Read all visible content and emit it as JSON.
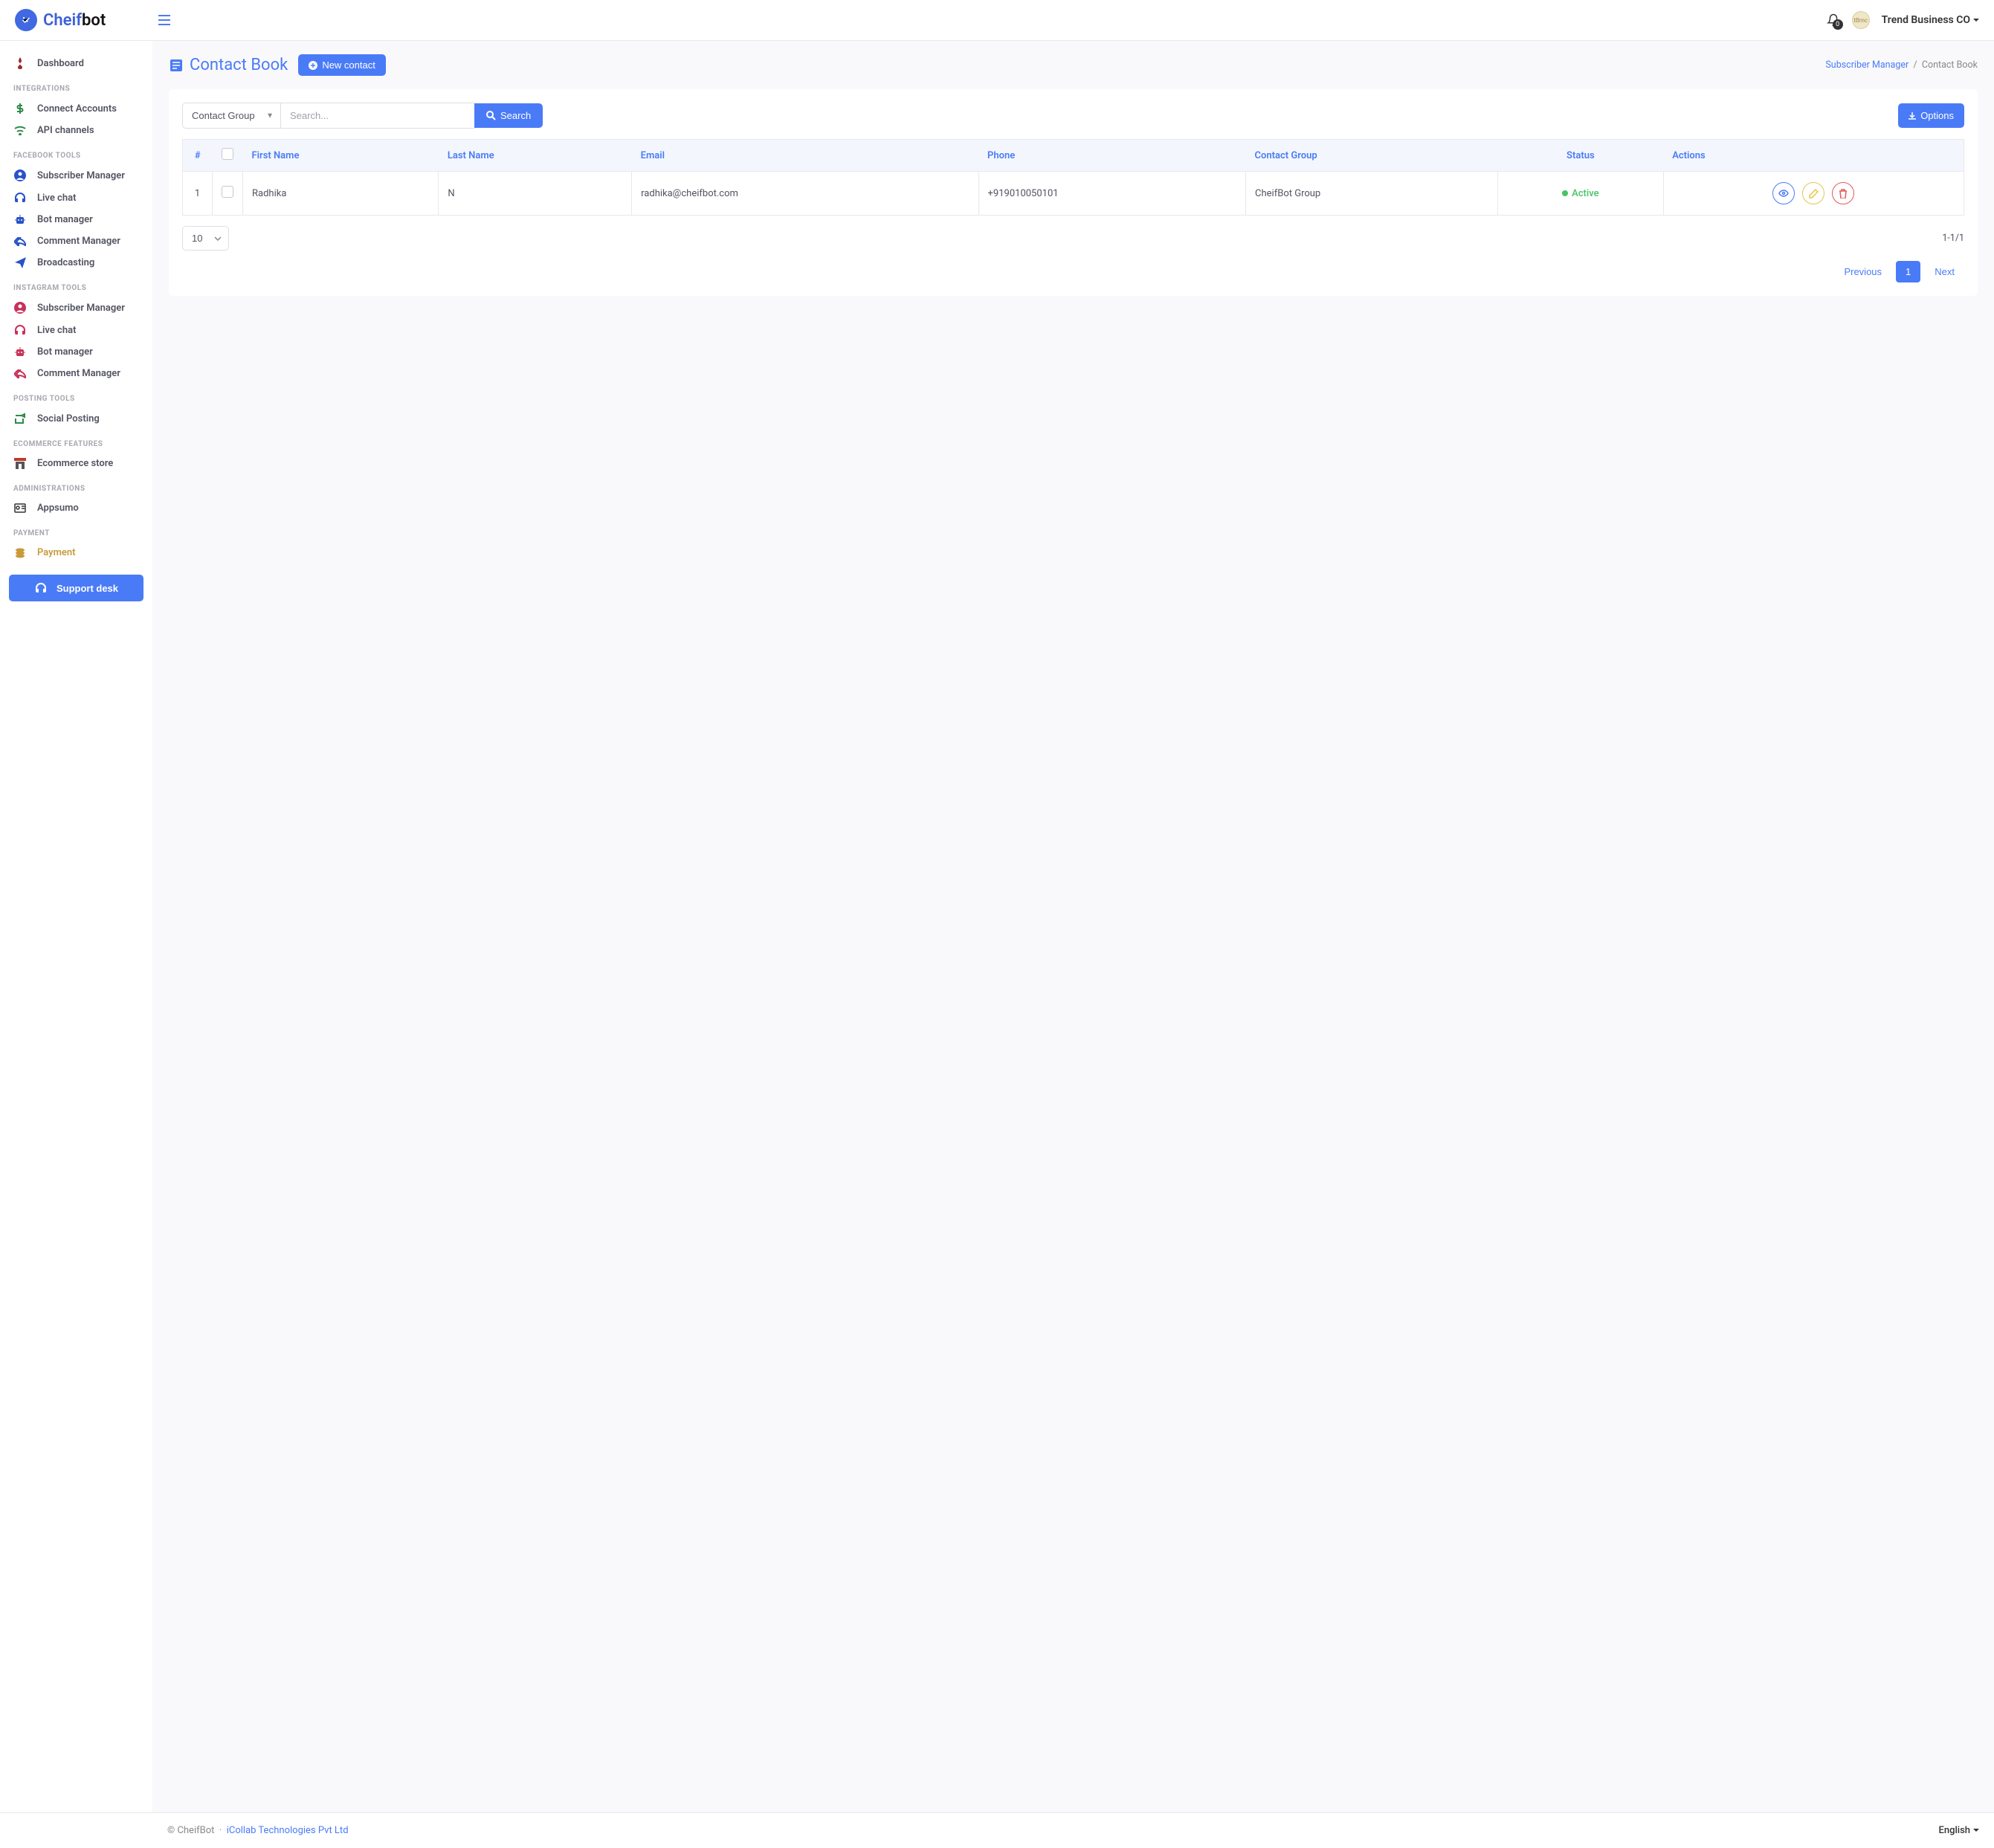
{
  "brand": {
    "part1": "Cheif",
    "part2": "bot"
  },
  "header": {
    "notification_count": "0",
    "account_name": "Trend Business CO"
  },
  "sidebar": {
    "dashboard": "Dashboard",
    "h_integrations": "INTEGRATIONS",
    "connect_accounts": "Connect Accounts",
    "api_channels": "API channels",
    "h_fb": "FACEBOOK TOOLS",
    "fb_sub": "Subscriber Manager",
    "fb_chat": "Live chat",
    "fb_bot": "Bot manager",
    "fb_comment": "Comment Manager",
    "fb_broadcast": "Broadcasting",
    "h_ig": "INSTAGRAM TOOLS",
    "ig_sub": "Subscriber Manager",
    "ig_chat": "Live chat",
    "ig_bot": "Bot manager",
    "ig_comment": "Comment Manager",
    "h_posting": "POSTING TOOLS",
    "social_posting": "Social Posting",
    "h_ecom": "ECOMMERCE FEATURES",
    "ecom_store": "Ecommerce store",
    "h_admin": "ADMINISTRATIONS",
    "appsumo": "Appsumo",
    "h_payment": "PAYMENT",
    "payment": "Payment",
    "support": "Support desk"
  },
  "page": {
    "title": "Contact Book",
    "new_contact": "New contact",
    "crumb_parent": "Subscriber Manager",
    "crumb_current": "Contact Book"
  },
  "filters": {
    "group_label": "Contact Group",
    "search_placeholder": "Search...",
    "search_btn": "Search",
    "options_btn": "Options"
  },
  "table": {
    "cols": {
      "num": "#",
      "first": "First Name",
      "last": "Last Name",
      "email": "Email",
      "phone": "Phone",
      "group": "Contact Group",
      "status": "Status",
      "actions": "Actions"
    },
    "rows": [
      {
        "num": "1",
        "first": "Radhika",
        "last": "N",
        "email": "radhika@cheifbot.com",
        "phone": "+919010050101",
        "group": "CheifBot Group",
        "status": "Active"
      }
    ],
    "page_size": "10",
    "range": "1-1/1"
  },
  "pager": {
    "prev": "Previous",
    "page": "1",
    "next": "Next"
  },
  "footer": {
    "copy": "© CheifBot",
    "sep": "·",
    "company": "iCollab Technologies Pvt Ltd",
    "lang": "English"
  }
}
